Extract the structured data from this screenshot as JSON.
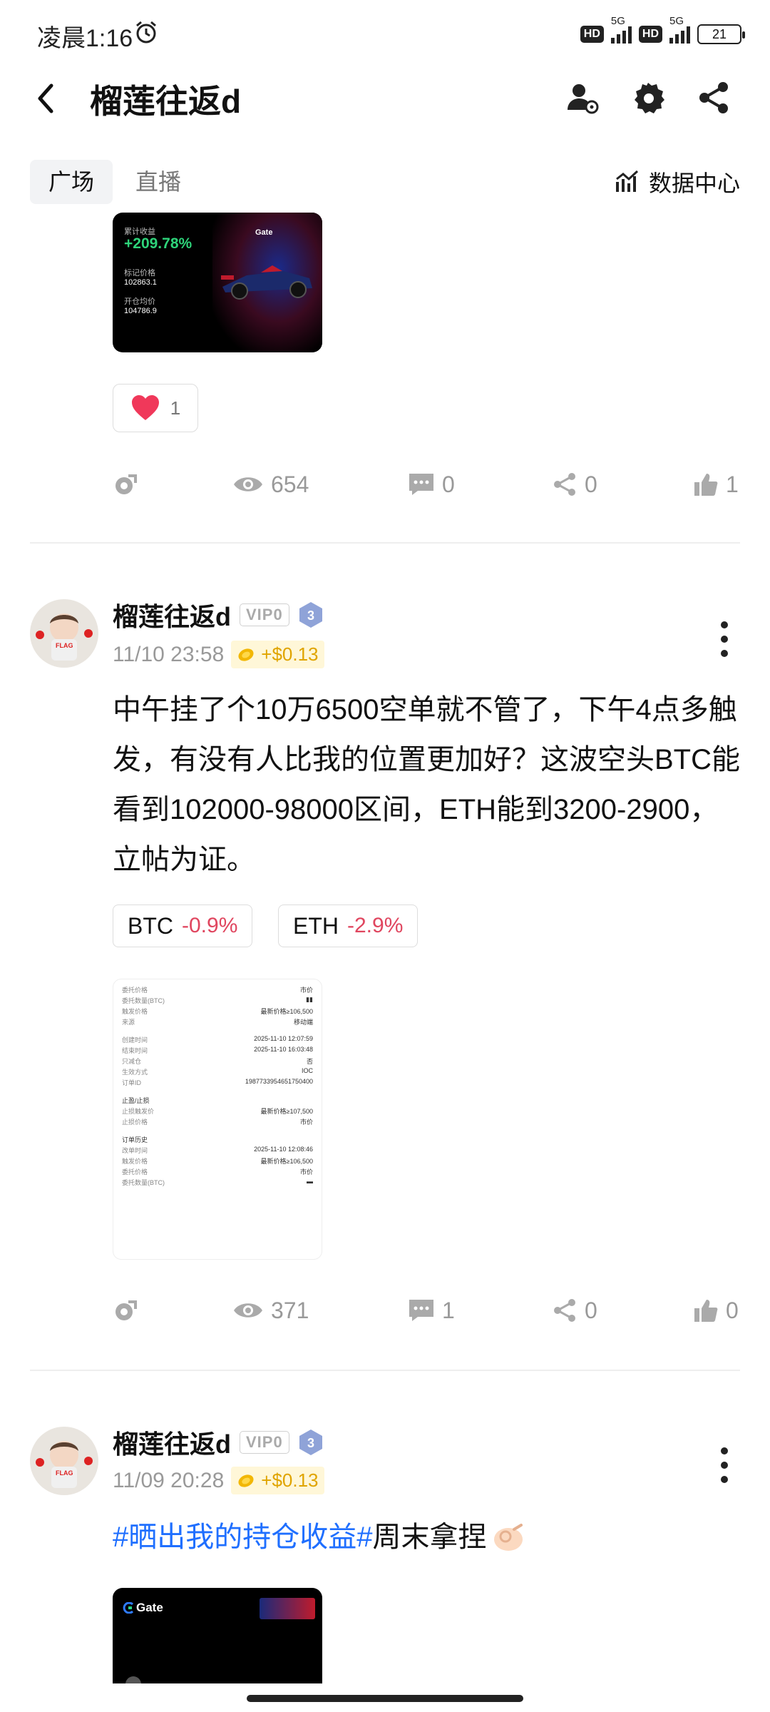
{
  "status": {
    "time": "凌晨1:16",
    "net1": "5G",
    "net2": "5G",
    "hd": "HD",
    "battery": "21"
  },
  "header": {
    "title": "榴莲往返d"
  },
  "tabs": [
    {
      "label": "广场"
    },
    {
      "label": "直播"
    }
  ],
  "data_center": "数据中心",
  "top_card": {
    "label": "累计收益",
    "pnl": "+209.78%",
    "mark_label": "标记价格",
    "mark_price": "102863.1",
    "open_label": "开仓均价",
    "open_price": "104786.9",
    "brand": "Gate"
  },
  "reaction": {
    "count": "1"
  },
  "post0_stats": {
    "views": "654",
    "comments": "0",
    "shares": "0",
    "likes": "1"
  },
  "post1": {
    "author": "榴莲往返d",
    "vip": "VIP0",
    "level": "3",
    "date": "11/10 23:58",
    "earn": "+$0.13",
    "body": "中午挂了个10万6500空单就不管了，下午4点多触发，有没有人比我的位置更加好？这波空头BTC能看到102000-98000区间，ETH能到3200-2900，立帖为证。",
    "tags": [
      {
        "symbol": "BTC",
        "change": "-0.9%"
      },
      {
        "symbol": "ETH",
        "change": "-2.9%"
      }
    ],
    "receipt": [
      [
        "委托价格",
        "市价"
      ],
      [
        "委托数量(BTC)",
        "▮▮"
      ],
      [
        "触发价格",
        "最新价格≥106,500"
      ],
      [
        "来源",
        "移动端"
      ],
      [
        "创建时间",
        "2025-11-10 12:07:59"
      ],
      [
        "结束时间",
        "2025-11-10 16:03:48"
      ],
      [
        "只减仓",
        "否"
      ],
      [
        "生效方式",
        "IOC"
      ],
      [
        "订单ID",
        "1987733954651750400"
      ],
      [
        "止盈/止损",
        ""
      ],
      [
        "止损触发价",
        "最新价格≥107,500"
      ],
      [
        "止损价格",
        "市价"
      ],
      [
        "订单历史",
        ""
      ],
      [
        "改单时间",
        "2025-11-10 12:08:46"
      ],
      [
        "触发价格",
        "最新价格≥106,500"
      ],
      [
        "委托价格",
        "市价"
      ],
      [
        "委托数量(BTC)",
        "▬"
      ]
    ],
    "stats": {
      "views": "371",
      "comments": "1",
      "shares": "0",
      "likes": "0"
    }
  },
  "post2": {
    "author": "榴莲往返d",
    "vip": "VIP0",
    "level": "3",
    "date": "11/09 20:28",
    "earn": "+$0.13",
    "hashtag": "#晒出我的持仓收益#",
    "text": "周末拿捏",
    "card_brand": "Gate"
  },
  "colors": {
    "accent_blue": "#1f6fff",
    "negative": "#e0465f",
    "earn_gold": "#e0a400",
    "pnl_green": "#2ed47a"
  }
}
